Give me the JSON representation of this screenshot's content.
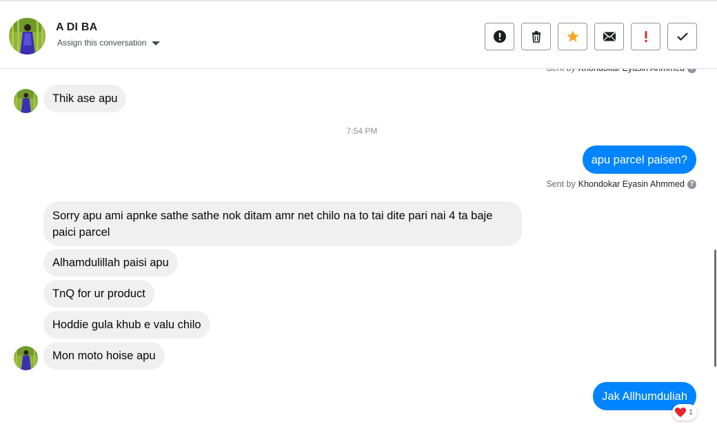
{
  "header": {
    "contact_name": "A DI BA",
    "assign_label": "Assign this conversation"
  },
  "actions": [
    {
      "name": "mark-spam-button",
      "icon": "alert-circle-icon",
      "color": "#1c1e21"
    },
    {
      "name": "delete-button",
      "icon": "trash-icon",
      "color": "#1c1e21"
    },
    {
      "name": "star-button",
      "icon": "star-icon",
      "color": "#f5a623"
    },
    {
      "name": "mark-unread-button",
      "icon": "envelope-icon",
      "color": "#1c1e21"
    },
    {
      "name": "follow-up-button",
      "icon": "exclamation-icon",
      "color": "#e02020"
    },
    {
      "name": "done-button",
      "icon": "checkmark-icon",
      "color": "#1c1e21"
    }
  ],
  "messages": {
    "sent_by_prefix": "Sent by",
    "sender_name": "Khondokar Eyasin Ahmmed",
    "in_1": "Thik ase apu",
    "timestamp": "7:54 PM",
    "out_1": "apu parcel paisen?",
    "in_2": "Sorry apu ami apnke sathe sathe nok ditam amr net chilo na to tai dite pari nai 4 ta baje paici parcel",
    "in_3": "Alhamdulillah paisi apu",
    "in_4": "TnQ for ur product",
    "in_5": "Hoddie gula khub e valu chilo",
    "in_6": "Mon moto hoise apu",
    "out_2": "Jak Allhumduliah",
    "reaction_emoji": "heart",
    "reaction_count": "1"
  },
  "colors": {
    "accent_blue": "#0084ff",
    "incoming_bubble": "#f0f0f0",
    "star": "#f5a623",
    "alert_red": "#e02020"
  }
}
